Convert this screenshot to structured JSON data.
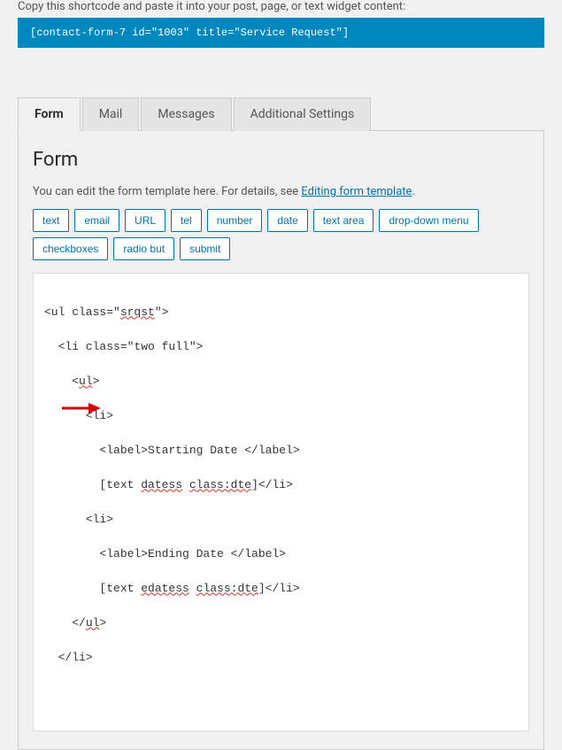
{
  "shortcode": {
    "instruction": "Copy this shortcode and paste it into your post, page, or text widget content:",
    "value": "[contact-form-7 id=\"1003\" title=\"Service Request\"]"
  },
  "tabs": {
    "form": "Form",
    "mail": "Mail",
    "messages": "Messages",
    "additional": "Additional Settings"
  },
  "form_panel": {
    "heading": "Form",
    "desc_pre": "You can edit the form template here. For details, see ",
    "desc_link": "Editing form template",
    "desc_post": ".",
    "tag_buttons": {
      "text": "text",
      "email": "email",
      "url": "URL",
      "tel": "tel",
      "number": "number",
      "date": "date",
      "textarea": "text area",
      "dropdown": "drop-down menu",
      "checkboxes": "checkboxes",
      "radio": "radio but",
      "submit": "submit"
    },
    "code": {
      "l1a": "<ul class=\"",
      "l1b": "srqst",
      "l1c": "\">",
      "l2": "  <li class=\"two full\">",
      "l3a": "    <",
      "l3b": "ul",
      "l3c": ">",
      "l4": "      <li>",
      "l5": "        <label>Starting Date </label>",
      "l6a": "        [text ",
      "l6b": "datess",
      "l6c": " ",
      "l6d": "class:dte",
      "l6e": "]</li>",
      "l7": "      <li>",
      "l8": "        <label>Ending Date </label>",
      "l9a": "        [text ",
      "l9b": "edatess",
      "l9c": " ",
      "l9d": "class:dte",
      "l9e": "]</li>",
      "l10a": "    </",
      "l10b": "ul",
      "l10c": ">",
      "l11": "  </li>"
    }
  }
}
